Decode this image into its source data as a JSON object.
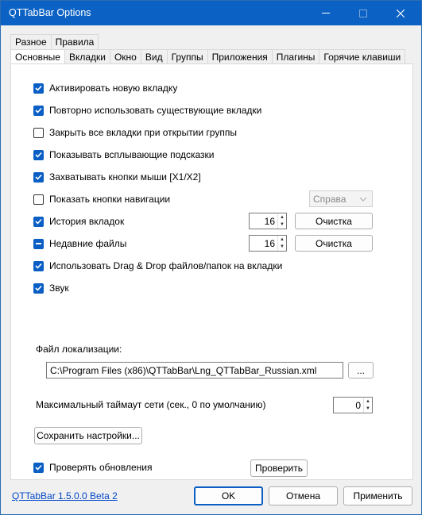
{
  "window": {
    "title": "QTTabBar Options"
  },
  "tabs_row1": [
    "Разное",
    "Правила"
  ],
  "tabs_row2": [
    "Основные",
    "Вкладки",
    "Окно",
    "Вид",
    "Группы",
    "Приложения",
    "Плагины",
    "Горячие клавиши"
  ],
  "options": {
    "activate_new_tab": "Активировать новую вкладку",
    "reuse_tabs": "Повторно использовать существующие вкладки",
    "close_tabs_on_group": "Закрыть все вкладки при открытии группы",
    "show_tooltips": "Показывать всплывающие подсказки",
    "capture_mouse_buttons": "Захватывать кнопки мыши [X1/X2]",
    "show_nav_buttons": "Показать кнопки навигации",
    "nav_position": "Справа",
    "tab_history": "История вкладок",
    "tab_history_count": "16",
    "recent_files": "Недавние файлы",
    "recent_files_count": "16",
    "clear_label": "Очистка",
    "drag_drop": "Использовать Drag & Drop файлов/папок на вкладки",
    "sound": "Звук"
  },
  "localization": {
    "label": "Файл локализации:",
    "path": "C:\\Program Files (x86)\\QTTabBar\\Lng_QTTabBar_Russian.xml",
    "browse": "..."
  },
  "network": {
    "label": "Максимальный таймаут сети (сек., 0 по умолчанию)",
    "value": "0"
  },
  "save_settings": "Сохранить настройки...",
  "updates": {
    "label": "Проверять обновления",
    "check_button": "Проверить"
  },
  "footer": {
    "version_link": "QTTabBar 1.5.0.0 Beta 2",
    "ok": "OK",
    "cancel": "Отмена",
    "apply": "Применить"
  }
}
